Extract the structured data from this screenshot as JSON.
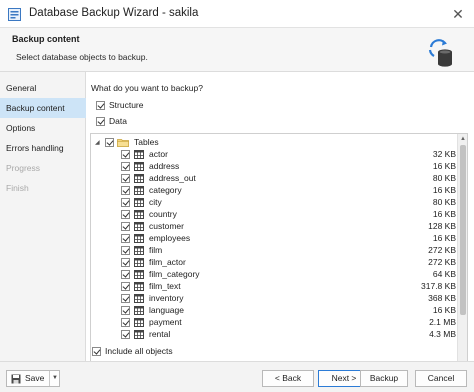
{
  "window": {
    "title": "Database Backup Wizard - sakila",
    "close_glyph": "✕"
  },
  "header": {
    "title": "Backup content",
    "subtitle": "Select database objects to backup."
  },
  "sidebar": {
    "items": [
      {
        "label": "General",
        "state": "normal"
      },
      {
        "label": "Backup content",
        "state": "active"
      },
      {
        "label": "Options",
        "state": "normal"
      },
      {
        "label": "Errors handling",
        "state": "normal"
      },
      {
        "label": "Progress",
        "state": "disabled"
      },
      {
        "label": "Finish",
        "state": "disabled"
      }
    ]
  },
  "content": {
    "question": "What do you want to backup?",
    "structure_label": "Structure",
    "structure_checked": true,
    "data_label": "Data",
    "data_checked": true,
    "tree": {
      "root_label": "Tables",
      "root_checked": true,
      "expanded": true,
      "items": [
        {
          "name": "actor",
          "size": "32 KB",
          "checked": true
        },
        {
          "name": "address",
          "size": "16 KB",
          "checked": true
        },
        {
          "name": "address_out",
          "size": "80 KB",
          "checked": true
        },
        {
          "name": "category",
          "size": "16 KB",
          "checked": true
        },
        {
          "name": "city",
          "size": "80 KB",
          "checked": true
        },
        {
          "name": "country",
          "size": "16 KB",
          "checked": true
        },
        {
          "name": "customer",
          "size": "128 KB",
          "checked": true
        },
        {
          "name": "employees",
          "size": "16 KB",
          "checked": true
        },
        {
          "name": "film",
          "size": "272 KB",
          "checked": true
        },
        {
          "name": "film_actor",
          "size": "272 KB",
          "checked": true
        },
        {
          "name": "film_category",
          "size": "64 KB",
          "checked": true
        },
        {
          "name": "film_text",
          "size": "317.8 KB",
          "checked": true
        },
        {
          "name": "inventory",
          "size": "368 KB",
          "checked": true
        },
        {
          "name": "language",
          "size": "16 KB",
          "checked": true
        },
        {
          "name": "payment",
          "size": "2.1 MB",
          "checked": true
        },
        {
          "name": "rental",
          "size": "4.3 MB",
          "checked": true
        }
      ]
    },
    "include_all_label": "Include all objects",
    "include_all_checked": true
  },
  "footer": {
    "save_label": "Save",
    "back_label": "< Back",
    "next_label": "Next >",
    "backup_label": "Backup",
    "cancel_label": "Cancel"
  },
  "colors": {
    "active_nav_bg": "#cde4f7",
    "accent_blue": "#2b7bd6",
    "disabled_text": "#a9a9a9"
  },
  "icons": {
    "app": "database-app-icon",
    "header": "database-sync-icon",
    "table": "table-grid-icon",
    "folder": "folder-icon",
    "save": "floppy-save-icon"
  }
}
